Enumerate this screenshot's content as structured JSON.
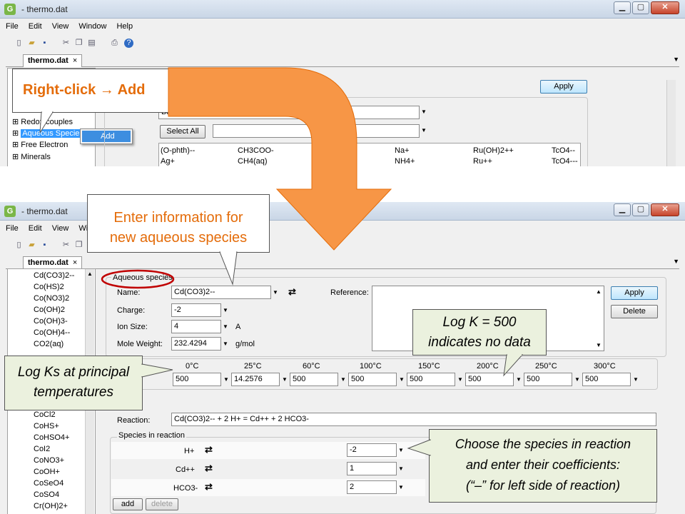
{
  "app": {
    "title": "- thermo.dat",
    "icon_letter": "G"
  },
  "menu": [
    "File",
    "Edit",
    "View",
    "Window",
    "Help"
  ],
  "tab": {
    "label": "thermo.dat",
    "close": "×"
  },
  "top": {
    "callout_label": "Right-click → Add",
    "tree": [
      "Redox couples",
      "Aqueous Species",
      "Free Electron",
      "Minerals"
    ],
    "context_menu_item": "Add",
    "apply_label": "Apply",
    "basis_select": "Basis and Redox Species",
    "select_all_label": "Select All",
    "species_grid": [
      [
        "(O-phth)--",
        "CH3COO-",
        "",
        "Na+",
        "Ru(OH)2++",
        "TcO4--"
      ],
      [
        "Ag+",
        "CH4(aq)",
        "",
        "NH4+",
        "Ru++",
        "TcO4---"
      ]
    ]
  },
  "bottom": {
    "callout_enter": [
      "Enter information for",
      "new aqueous species"
    ],
    "callout_logk": [
      "Log K = 500",
      "indicates no data"
    ],
    "callout_logks": [
      "Log Ks at principal",
      "temperatures"
    ],
    "callout_choose": [
      "Choose the species in reaction",
      "and enter their coefficients:",
      "(“–” for left side of reaction)"
    ],
    "tree": [
      "Cd(CO3)2--",
      "Co(HS)2",
      "Co(NO3)2",
      "Co(OH)2",
      "Co(OH)3-",
      "Co(OH)4--",
      "CO2(aq)",
      "CoCl2",
      "CoHS+",
      "CoHSO4+",
      "CoI2",
      "CoNO3+",
      "CoOH+",
      "CoSeO4",
      "CoSO4",
      "Cr(OH)2+"
    ],
    "group_label": "Aqueous species",
    "name_label": "Name:",
    "name_value": "Cd(CO3)2--",
    "charge_label": "Charge:",
    "charge_value": "-2",
    "ion_size_label": "Ion Size:",
    "ion_size_value": "4",
    "ion_size_unit": "A",
    "mole_weight_label": "Mole Weight:",
    "mole_weight_value": "232.4294",
    "mole_weight_unit": "g/mol",
    "reference_label": "Reference:",
    "apply_label": "Apply",
    "delete_label": "Delete",
    "temperatures": [
      "0°C",
      "25°C",
      "60°C",
      "100°C",
      "150°C",
      "200°C",
      "250°C",
      "300°C"
    ],
    "logk_values": [
      "500",
      "14.2576",
      "500",
      "500",
      "500",
      "500",
      "500",
      "500"
    ],
    "reaction_label": "Reaction:",
    "reaction_value": "Cd(CO3)2--  + 2 H+  = Cd++  + 2 HCO3-",
    "species_group_label": "Species in reaction",
    "species_rows": [
      {
        "name": "H+",
        "coef": "-2"
      },
      {
        "name": "Cd++",
        "coef": "1"
      },
      {
        "name": "HCO3-",
        "coef": "2"
      }
    ],
    "add_label": "add",
    "delete_small_label": "delete"
  },
  "colors": {
    "orange": "#f79646",
    "orange_text": "#e46c0a",
    "green_callout": "#ebf1de",
    "red_circle": "#c00000"
  }
}
